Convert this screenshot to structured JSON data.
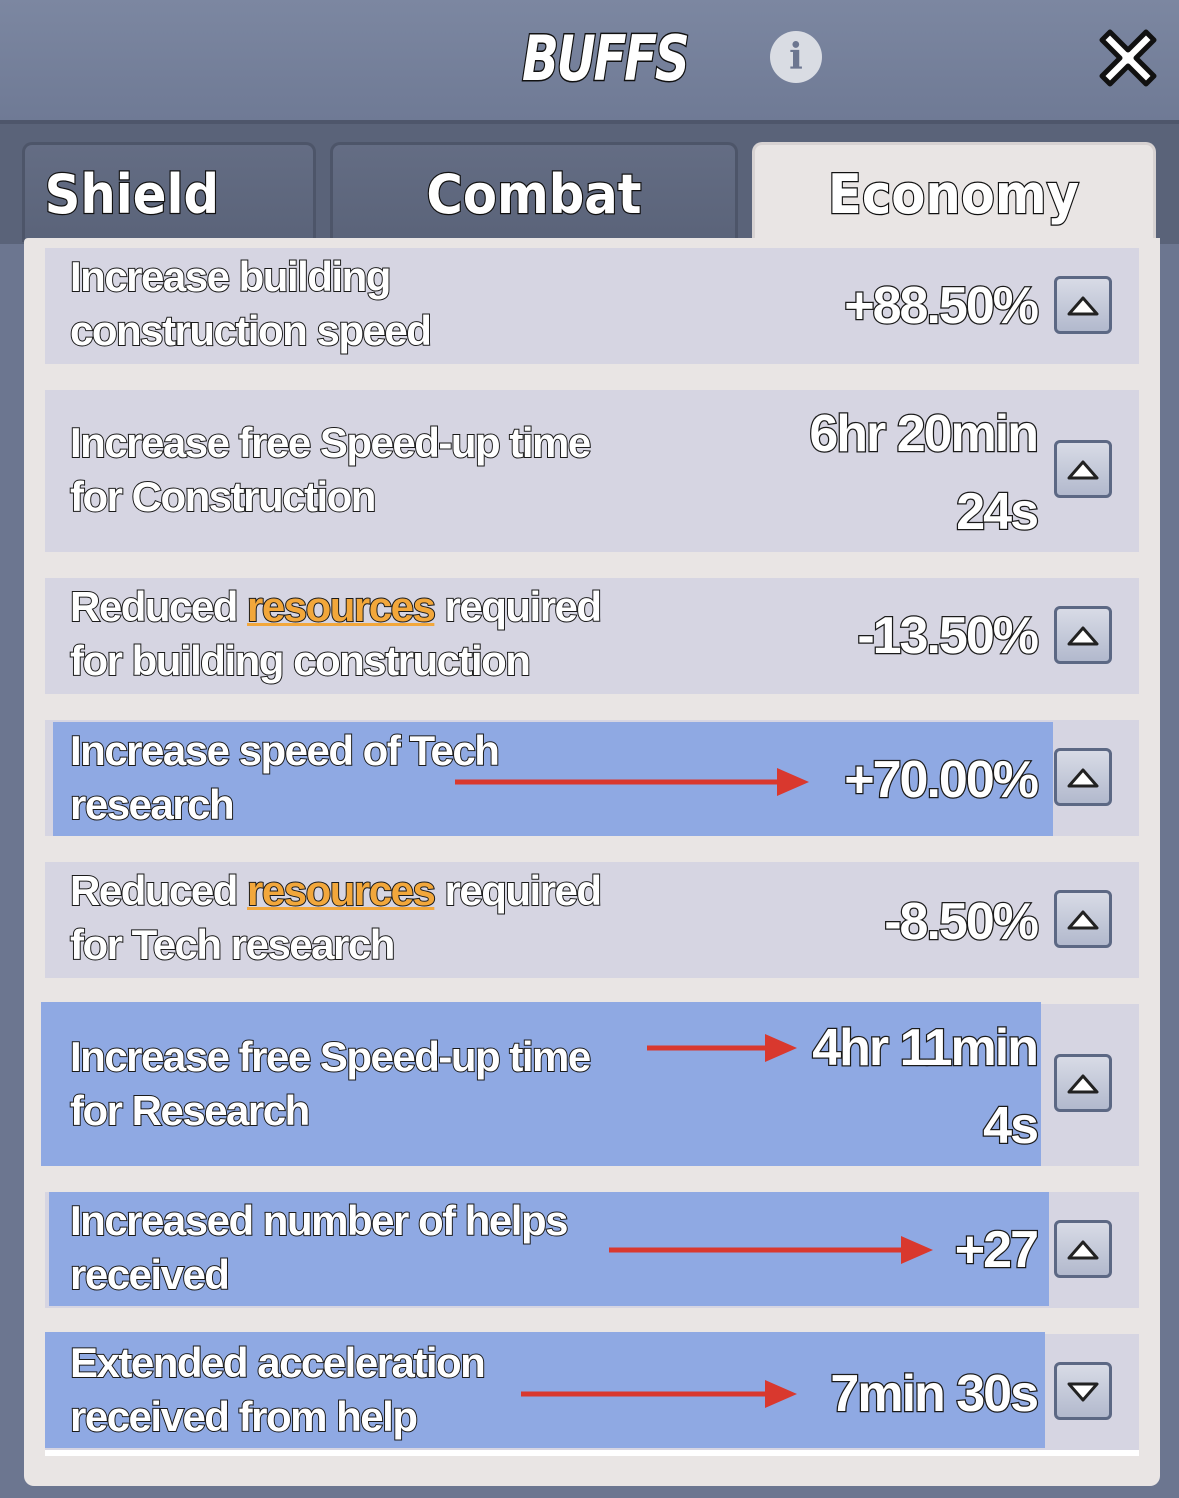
{
  "window": {
    "title": "BUFFS"
  },
  "tabs": [
    {
      "label": "Shield",
      "active": false
    },
    {
      "label": "Combat",
      "active": false
    },
    {
      "label": "Economy",
      "active": true
    }
  ],
  "buffs": [
    {
      "label_line1": "Increase building",
      "label_line2": "construction speed",
      "value_line1": "+88.50%",
      "value_line2": "",
      "highlighted": false,
      "arrow": false,
      "button": "up"
    },
    {
      "label_line1": "Increase free Speed-up time",
      "label_line2": "for Construction",
      "value_line1": "6hr 20min",
      "value_line2": "24s",
      "highlighted": false,
      "arrow": false,
      "button": "up"
    },
    {
      "label_pre": "Reduced ",
      "label_link": "resources",
      "label_post": " required",
      "label_line2": "for building construction",
      "value_line1": "-13.50%",
      "value_line2": "",
      "highlighted": false,
      "arrow": false,
      "button": "up"
    },
    {
      "label_line1": "Increase speed of Tech",
      "label_line2": "research",
      "value_line1": "+70.00%",
      "value_line2": "",
      "highlighted": true,
      "arrow": true,
      "button": "up"
    },
    {
      "label_pre": "Reduced ",
      "label_link": "resources",
      "label_post": " required",
      "label_line2": "for Tech research",
      "value_line1": "-8.50%",
      "value_line2": "",
      "highlighted": false,
      "arrow": false,
      "button": "up"
    },
    {
      "label_line1": "Increase free Speed-up time",
      "label_line2": "for Research",
      "value_line1": "4hr 11min",
      "value_line2": "4s",
      "highlighted": true,
      "arrow": true,
      "button": "up"
    },
    {
      "label_line1": "Increased number of helps",
      "label_line2": "received",
      "value_line1": "+27",
      "value_line2": "",
      "highlighted": true,
      "arrow": true,
      "button": "up"
    },
    {
      "label_line1": "Extended acceleration",
      "label_line2": "received from help",
      "value_line1": "7min 30s",
      "value_line2": "",
      "highlighted": true,
      "arrow": true,
      "button": "down"
    }
  ],
  "colors": {
    "highlight": "#8fa9e3",
    "row": "#d6d5e2",
    "arrow": "#d9382e",
    "link": "#f2a73b"
  },
  "icons": [
    "info-icon",
    "close-icon",
    "chevron-up-icon",
    "chevron-down-icon",
    "arrow-right-icon"
  ]
}
